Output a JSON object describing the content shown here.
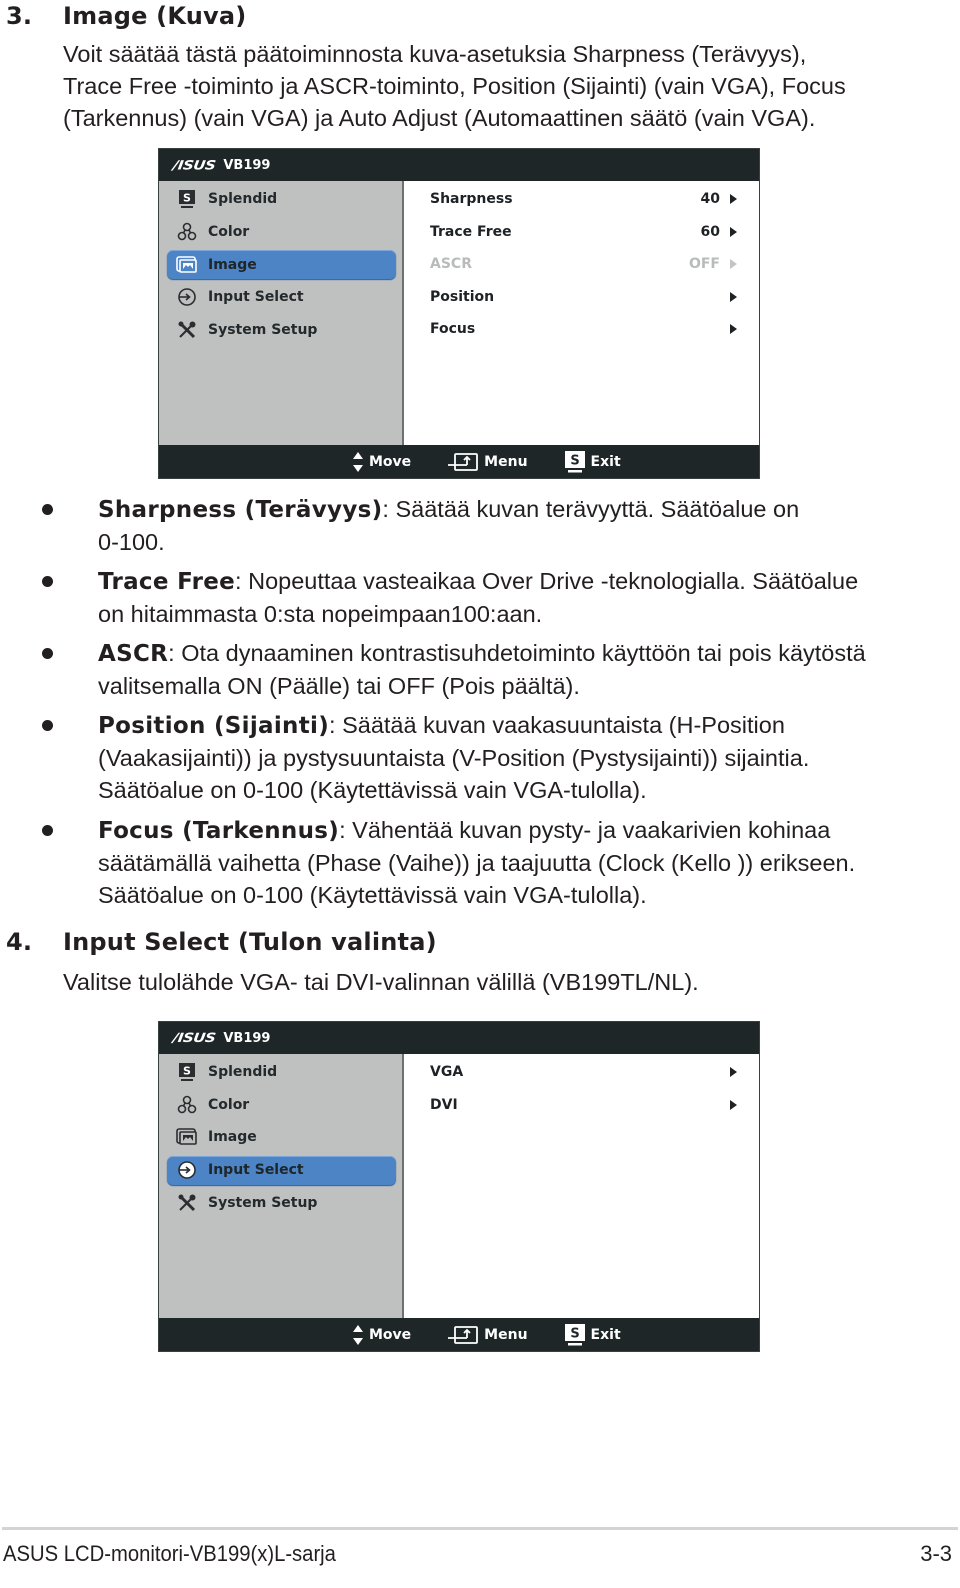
{
  "section3": {
    "number": "3.",
    "title": "Image (Kuva)",
    "intro_lines": [
      "Voit säätää tästä päätoiminnosta kuva-asetuksia Sharpness (Terävyys),",
      "Trace Free -toiminto ja ASCR-toiminto, Position (Sijainti) (vain VGA), Focus",
      "(Tarkennus) (vain VGA) ja Auto Adjust (Automaattinen säätö (vain VGA)."
    ]
  },
  "osd_image": {
    "logo": "/ISUS",
    "model": "VB199",
    "menu": [
      {
        "label": "Splendid",
        "icon": "splendid-icon",
        "selected": false
      },
      {
        "label": "Color",
        "icon": "color-icon",
        "selected": false
      },
      {
        "label": "Image",
        "icon": "image-icon",
        "selected": true
      },
      {
        "label": "Input Select",
        "icon": "input-select-icon",
        "selected": false
      },
      {
        "label": "System Setup",
        "icon": "system-setup-icon",
        "selected": false
      }
    ],
    "options": [
      {
        "label": "Sharpness",
        "value": "40",
        "disabled": false
      },
      {
        "label": "Trace Free",
        "value": "60",
        "disabled": false
      },
      {
        "label": "ASCR",
        "value": "OFF",
        "disabled": true
      },
      {
        "label": "Position",
        "value": "",
        "disabled": false
      },
      {
        "label": "Focus",
        "value": "",
        "disabled": false
      }
    ],
    "footer": {
      "move": "Move",
      "menu": "Menu",
      "exit": "Exit",
      "exit_key": "S"
    }
  },
  "bullets": [
    {
      "term": "Sharpness (Terävyys)",
      "lines": [
        ": Säätää kuvan terävyyttä. Säätöalue on",
        "0-100."
      ]
    },
    {
      "term": "Trace Free",
      "lines": [
        ": Nopeuttaa vasteaikaa Over Drive -teknologialla. Säätöalue",
        "on hitaimmasta 0:sta nopeimpaan100:aan."
      ]
    },
    {
      "term": "ASCR",
      "lines": [
        ": Ota dynaaminen kontrastisuhdetoiminto käyttöön tai pois käytöstä",
        "valitsemalla ON (Päälle) tai OFF (Pois päältä)."
      ]
    },
    {
      "term": "Position (Sijainti)",
      "lines": [
        ": Säätää kuvan vaakasuuntaista (H-Position",
        "(Vaakasijainti)) ja pystysuuntaista (V-Position (Pystysijainti)) sijaintia.",
        "Säätöalue on 0-100 (Käytettävissä vain VGA-tulolla)."
      ]
    },
    {
      "term": "Focus (Tarkennus)",
      "lines": [
        ": Vähentää kuvan pysty- ja vaakarivien kohinaa",
        "säätämällä vaihetta (Phase (Vaihe)) ja taajuutta (Clock (Kello )) erikseen.",
        "Säätöalue on 0-100 (Käytettävissä vain VGA-tulolla)."
      ]
    }
  ],
  "section4": {
    "number": "4.",
    "title": "Input Select (Tulon valinta)",
    "intro": "Valitse tulolähde VGA- tai DVI-valinnan välillä (VB199TL/NL)."
  },
  "osd_input": {
    "logo": "/ISUS",
    "model": "VB199",
    "menu": [
      {
        "label": "Splendid",
        "icon": "splendid-icon",
        "selected": false
      },
      {
        "label": "Color",
        "icon": "color-icon",
        "selected": false
      },
      {
        "label": "Image",
        "icon": "image-icon",
        "selected": false
      },
      {
        "label": "Input Select",
        "icon": "input-select-icon",
        "selected": true
      },
      {
        "label": "System Setup",
        "icon": "system-setup-icon",
        "selected": false
      }
    ],
    "options": [
      {
        "label": "VGA",
        "value": "",
        "disabled": false
      },
      {
        "label": "DVI",
        "value": "",
        "disabled": false
      }
    ],
    "footer": {
      "move": "Move",
      "menu": "Menu",
      "exit": "Exit",
      "exit_key": "S"
    }
  },
  "page_footer": {
    "left": "ASUS LCD-monitori-VB199(x)L-sarja",
    "right": "3-3"
  }
}
